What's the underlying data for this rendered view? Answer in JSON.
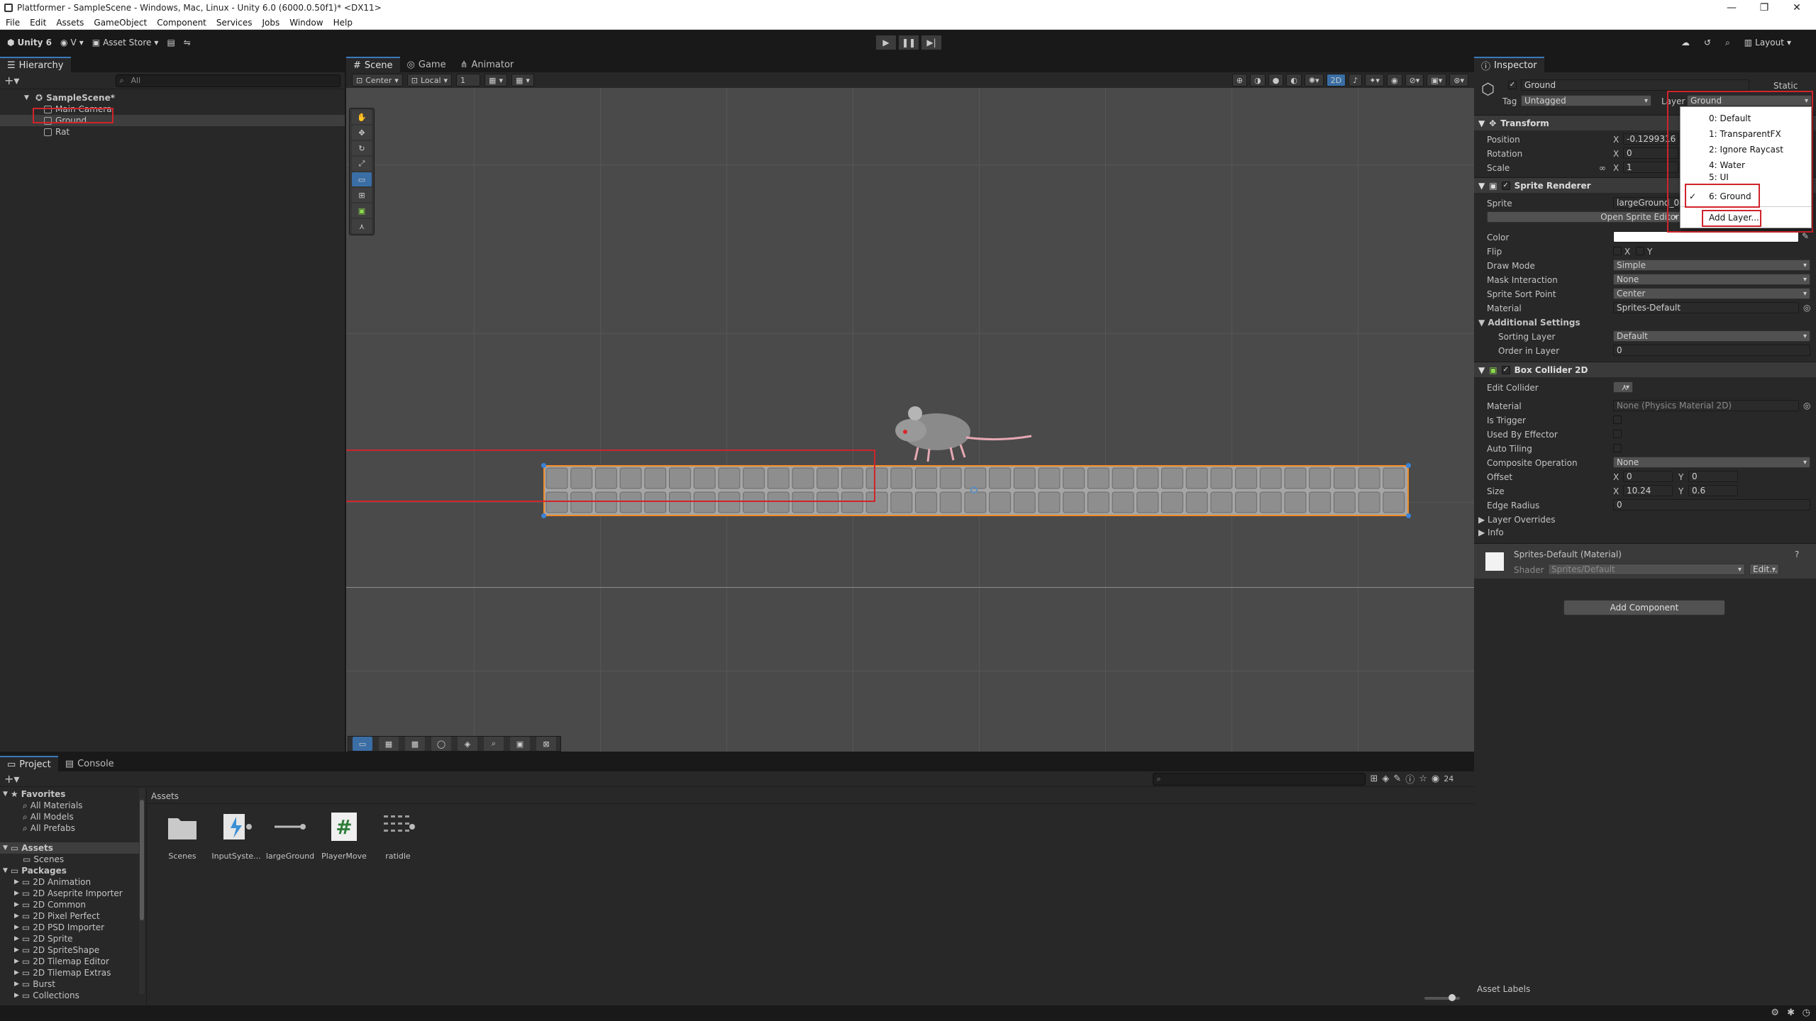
{
  "window": {
    "title": "Plattformer - SampleScene - Windows, Mac, Linux - Unity 6.0 (6000.0.50f1)* <DX11>",
    "controls": [
      "—",
      "❐",
      "✕"
    ]
  },
  "menu": [
    "File",
    "Edit",
    "Assets",
    "GameObject",
    "Component",
    "Services",
    "Jobs",
    "Window",
    "Help"
  ],
  "toolbar": {
    "unity_label": "Unity 6",
    "account_label": "V",
    "asset_store_label": "Asset Store",
    "layout_label": "Layout"
  },
  "hierarchy": {
    "tab_label": "Hierarchy",
    "search_placeholder": "All",
    "scene_name": "SampleScene*",
    "items": [
      "Main Camera",
      "Ground",
      "Rat"
    ]
  },
  "scene_tabs": [
    "Scene",
    "Game",
    "Animator"
  ],
  "scene_toolbar": {
    "pivot_label": "Center",
    "space_label": "Local",
    "grid_value": "1",
    "mode_2d_label": "2D"
  },
  "inspector": {
    "tab_label": "Inspector",
    "object_name": "Ground",
    "static_label": "Static",
    "tag_label": "Tag",
    "tag_value": "Untagged",
    "layer_label": "Layer",
    "layer_value": "Ground",
    "transform": {
      "header": "Transform",
      "position_label": "Position",
      "rotation_label": "Rotation",
      "scale_label": "Scale",
      "axis_x": "X",
      "position_x": "-0.1299316",
      "rotation_x": "0",
      "scale_x": "1"
    },
    "sprite_renderer": {
      "header": "Sprite Renderer",
      "sprite_label": "Sprite",
      "sprite_value": "largeGround_0",
      "open_editor_label": "Open Sprite Editor",
      "color_label": "Color",
      "flip_label": "Flip",
      "flip_x": "X",
      "flip_y": "Y",
      "draw_mode_label": "Draw Mode",
      "draw_mode_value": "Simple",
      "mask_label": "Mask Interaction",
      "mask_value": "None",
      "sort_point_label": "Sprite Sort Point",
      "sort_point_value": "Center",
      "material_label": "Material",
      "material_value": "Sprites-Default",
      "additional_label": "Additional Settings",
      "sorting_layer_label": "Sorting Layer",
      "sorting_layer_value": "Default",
      "order_label": "Order in Layer",
      "order_value": "0"
    },
    "box_collider": {
      "header": "Box Collider 2D",
      "edit_collider_label": "Edit Collider",
      "material_label": "Material",
      "material_value": "None (Physics Material 2D)",
      "is_trigger_label": "Is Trigger",
      "used_by_effector_label": "Used By Effector",
      "auto_tiling_label": "Auto Tiling",
      "composite_label": "Composite Operation",
      "composite_value": "None",
      "offset_label": "Offset",
      "offset_x": "0",
      "offset_y": "0",
      "size_label": "Size",
      "size_x": "10.24",
      "size_y": "0.6",
      "edge_radius_label": "Edge Radius",
      "edge_radius_value": "0",
      "layer_overrides_label": "Layer Overrides",
      "info_label": "Info"
    },
    "material_section": {
      "name": "Sprites-Default (Material)",
      "shader_label": "Shader",
      "shader_value": "Sprites/Default",
      "edit_label": "Edit..."
    },
    "add_component_label": "Add Component",
    "asset_labels": "Asset Labels"
  },
  "layer_dropdown": {
    "items": [
      "0: Default",
      "1: TransparentFX",
      "2: Ignore Raycast",
      "4: Water",
      "5: UI",
      "6: Ground"
    ],
    "selected": "6: Ground",
    "add_layer_label": "Add Layer..."
  },
  "project": {
    "tabs": [
      "Project",
      "Console"
    ],
    "favorites_label": "Favorites",
    "favorites": [
      "All Materials",
      "All Models",
      "All Prefabs"
    ],
    "assets_label": "Assets",
    "asset_folders": [
      "Scenes"
    ],
    "packages_label": "Packages",
    "packages": [
      "2D Animation",
      "2D Aseprite Importer",
      "2D Common",
      "2D Pixel Perfect",
      "2D PSD Importer",
      "2D Sprite",
      "2D SpriteShape",
      "2D Tilemap Editor",
      "2D Tilemap Extras",
      "Burst",
      "Collections"
    ],
    "breadcrumb": "Assets",
    "asset_count": "24",
    "assets": [
      "Scenes",
      "InputSyste...",
      "largeGround",
      "PlayerMove",
      "ratidle"
    ]
  },
  "colors": {
    "accent": "#3a79bb",
    "highlight": "#d0242b",
    "selection_outline": "#f28c28"
  }
}
